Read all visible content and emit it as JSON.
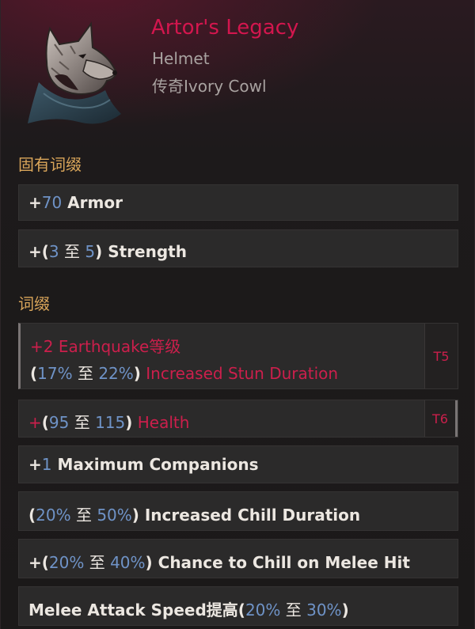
{
  "item": {
    "name": "Artor's Legacy",
    "type": "Helmet",
    "base": "传奇Ivory Cowl",
    "icon": "wolf-helmet-icon"
  },
  "sections": {
    "implicit_title": "固有词缀",
    "affix_title": "词缀"
  },
  "implicit": [
    {
      "p1": "+",
      "n1": "70",
      "text": " Armor"
    },
    {
      "p1": "+(",
      "n1": "3",
      "sep": " 至 ",
      "n2": "5",
      "p2": ")",
      "text": " Strength"
    }
  ],
  "affixes": [
    {
      "l1_prefix": "+",
      "l1_num": "2",
      "l1_text": " Earthquake等级",
      "l2_p1": "(",
      "l2_n1": "17%",
      "l2_sep": " 至 ",
      "l2_n2": "22%",
      "l2_p2": ")",
      "l2_text": " Increased Stun Duration",
      "tier": "T5"
    },
    {
      "prefix": "+",
      "p1": "(",
      "n1": "95",
      "sep": " 至 ",
      "n2": "115",
      "p2": ")",
      "text": " Health",
      "tier": "T6"
    },
    {
      "prefix": "+",
      "num": "1",
      "text": " Maximum Companions"
    },
    {
      "p1": "(",
      "n1": "20%",
      "sep": " 至 ",
      "n2": "50%",
      "p2": ")",
      "text": " Increased Chill Duration"
    },
    {
      "p1": "+(",
      "n1": "20%",
      "sep": " 至 ",
      "n2": "40%",
      "p2": ")",
      "text": " Chance to Chill on Melee Hit"
    },
    {
      "text": "Melee Attack Speed提高",
      "p1": "(",
      "n1": "20%",
      "sep": " 至 ",
      "n2": "30%",
      "p2": ")"
    }
  ],
  "colors": {
    "legendary": "#d3164e",
    "value_blue": "#6f93c7",
    "section_gold": "#d9a55a"
  }
}
